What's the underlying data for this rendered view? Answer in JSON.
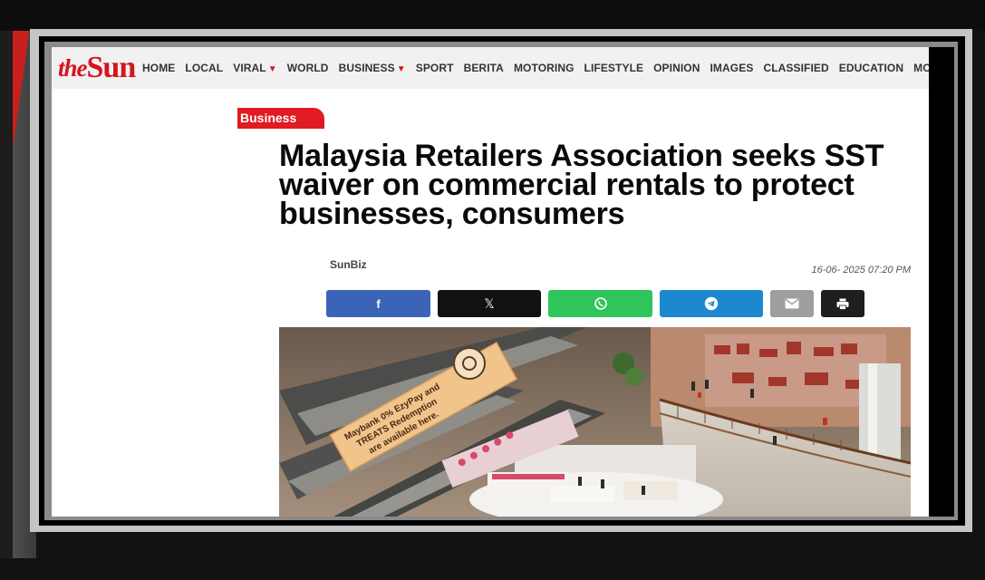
{
  "site": {
    "logo_the": "the",
    "logo_sun": "Sun",
    "brand_color": "#d6141c"
  },
  "nav": {
    "items": [
      {
        "label": "HOME",
        "dropdown": false
      },
      {
        "label": "LOCAL",
        "dropdown": false
      },
      {
        "label": "VIRAL",
        "dropdown": true
      },
      {
        "label": "WORLD",
        "dropdown": false
      },
      {
        "label": "BUSINESS",
        "dropdown": true
      },
      {
        "label": "SPORT",
        "dropdown": false
      },
      {
        "label": "BERITA",
        "dropdown": false
      },
      {
        "label": "MOTORING",
        "dropdown": false
      },
      {
        "label": "LIFESTYLE",
        "dropdown": false
      },
      {
        "label": "OPINION",
        "dropdown": false
      },
      {
        "label": "IMAGES",
        "dropdown": false
      },
      {
        "label": "CLASSIFIED",
        "dropdown": false
      },
      {
        "label": "EDUCATION",
        "dropdown": false
      },
      {
        "label": "MORE",
        "dropdown": true
      }
    ]
  },
  "article": {
    "category": "Business",
    "headline": "Malaysia Retailers Association seeks SST waiver on commercial rentals to protect businesses, consumers",
    "author": "SunBiz",
    "date": "16-06- 2025 07:20 PM"
  },
  "share": {
    "buttons": [
      {
        "name": "facebook",
        "icon": "facebook-icon",
        "glyph": "f",
        "color": "#3b64b8"
      },
      {
        "name": "x",
        "icon": "x-icon",
        "glyph": "𝕏",
        "color": "#111111"
      },
      {
        "name": "whatsapp",
        "icon": "whatsapp-icon",
        "glyph": "",
        "color": "#2fc55a"
      },
      {
        "name": "telegram",
        "icon": "telegram-icon",
        "glyph": "",
        "color": "#1d87d0"
      },
      {
        "name": "email",
        "icon": "email-icon",
        "glyph": "",
        "color": "#9e9e9e"
      },
      {
        "name": "print",
        "icon": "print-icon",
        "glyph": "",
        "color": "#1e1e1e"
      }
    ]
  },
  "photo": {
    "banner_text_1": "Maybank 0% EzyPay and",
    "banner_text_2": "TREATS Redemption",
    "banner_text_3": "are available here."
  }
}
